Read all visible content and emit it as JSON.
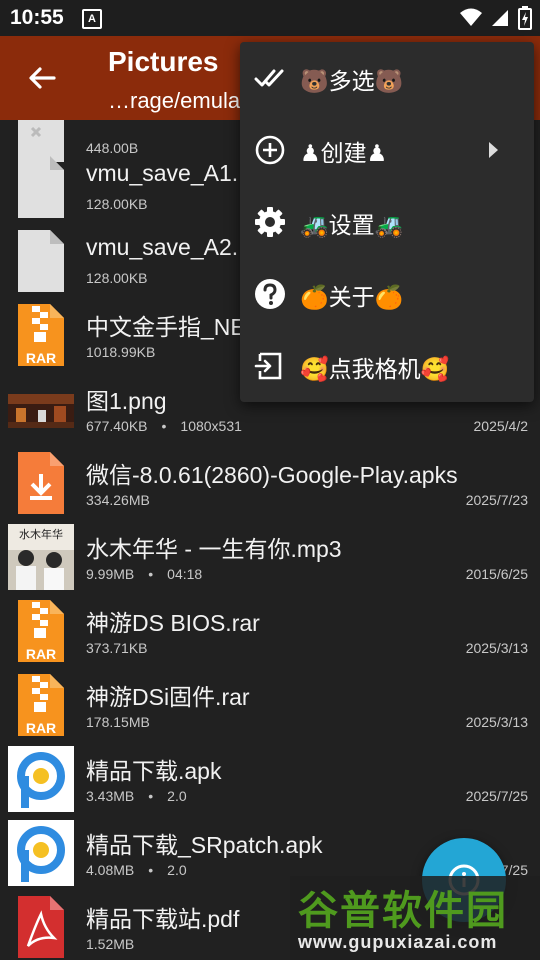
{
  "status_bar": {
    "time": "10:55",
    "notif_letter": "A"
  },
  "app_bar": {
    "title": "Pictures",
    "path": "…rage/emula"
  },
  "files": [
    {
      "name": "",
      "size": "448.00B",
      "extra": "",
      "date": "",
      "icon": "file-icon-partial"
    },
    {
      "name": "vmu_save_A1.",
      "size": "128.00KB",
      "extra": "",
      "date": "",
      "icon": "file-icon"
    },
    {
      "name": "vmu_save_A2.",
      "size": "128.00KB",
      "extra": "",
      "date": "",
      "icon": "file-icon"
    },
    {
      "name": "中文金手指_NE",
      "size": "1018.99KB",
      "extra": "",
      "date": "",
      "icon": "rar-icon"
    },
    {
      "name": "图1.png",
      "size": "677.40KB",
      "extra": "1080x531",
      "date": "2025/4/2",
      "icon": "image-thumb-game"
    },
    {
      "name": "微信-8.0.61(2860)-Google-Play.apks",
      "size": "334.26MB",
      "extra": "",
      "date": "2025/7/23",
      "icon": "download-icon"
    },
    {
      "name": "水木年华 - 一生有你.mp3",
      "size": "9.99MB",
      "extra": "04:18",
      "date": "2015/6/25",
      "icon": "album-thumb"
    },
    {
      "name": "神游DS BIOS.rar",
      "size": "373.71KB",
      "extra": "",
      "date": "2025/3/13",
      "icon": "rar-icon"
    },
    {
      "name": "神游DSi固件.rar",
      "size": "178.15MB",
      "extra": "",
      "date": "2025/3/13",
      "icon": "rar-icon"
    },
    {
      "name": "精品下载.apk",
      "size": "3.43MB",
      "extra": "2.0",
      "date": "2025/7/25",
      "icon": "apk-p-icon"
    },
    {
      "name": "精品下载_SRpatch.apk",
      "size": "4.08MB",
      "extra": "2.0",
      "date": "2025/7/25",
      "icon": "apk-p-icon"
    },
    {
      "name": "精品下载站.pdf",
      "size": "1.52MB",
      "extra": "",
      "date": "",
      "icon": "pdf-icon"
    }
  ],
  "dot": "•",
  "rar_label": "RAR",
  "album_text": "水木年华",
  "menu": {
    "items": [
      {
        "label": "🐻多选🐻",
        "icon": "double-check-icon"
      },
      {
        "label": "♟创建♟",
        "icon": "add-circle-icon",
        "submenu": true
      },
      {
        "label": "🚜设置🚜",
        "icon": "gear-icon"
      },
      {
        "label": "🍊关于🍊",
        "icon": "help-icon"
      },
      {
        "label": "🥰点我格机🥰",
        "icon": "exit-icon"
      }
    ]
  },
  "watermark": {
    "title": "谷普软件园",
    "url": "www.gupuxiazai.com"
  },
  "colors": {
    "app_bar": "#8b2b0b",
    "background": "#212121",
    "menu": "#2c2c2c",
    "fab": "#23a6d5",
    "rar": "#f7931e",
    "pdf": "#d32f2f"
  }
}
